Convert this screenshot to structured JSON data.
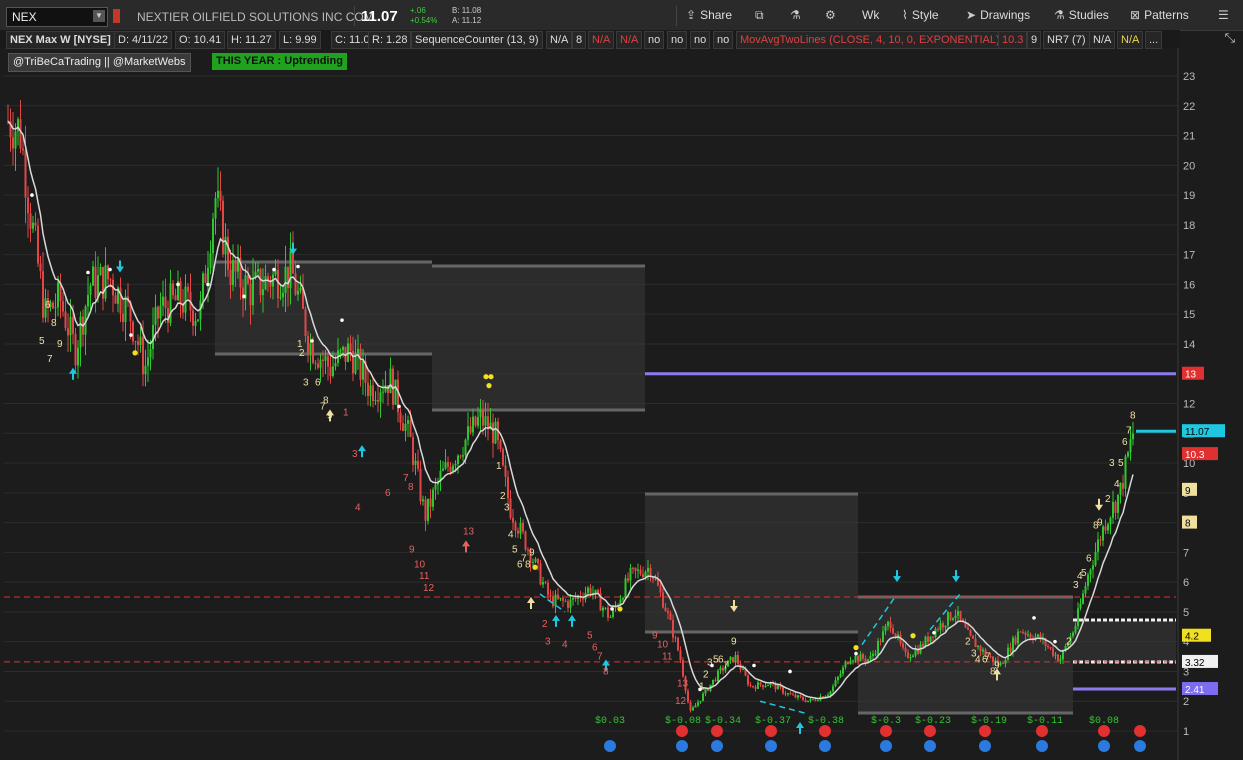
{
  "toolbar": {
    "symbol": "NEX",
    "company": "NEXTIER OILFIELD SOLUTIONS INC COM",
    "last": "11.07",
    "change": "+.06",
    "change_pct": "+0.54%",
    "bid": "B: 11.08",
    "ask": "A: 11.12",
    "share_label": "Share",
    "period_label": "Wk",
    "style_label": "Style",
    "drawings_label": "Drawings",
    "studies_label": "Studies",
    "patterns_label": "Patterns"
  },
  "studybar": {
    "title": "NEX Max W [NYSE]",
    "date": "D: 4/11/22",
    "open": "O: 10.41",
    "high": "H: 11.27",
    "low": "L: 9.99",
    "close": "C: 11.07",
    "range": "R: 1.28",
    "seq": "SequenceCounter (13, 9)",
    "v1": "N/A",
    "v2": "8",
    "v3": "N/A",
    "v4": "N/A",
    "no1": "no",
    "no2": "no",
    "no3": "no",
    "no4": "no",
    "mov": "MovAvgTwoLines (CLOSE, 4, 10, 0, EXPONENTIAL)",
    "mov_val": "10.3",
    "v5": "9",
    "nr7": "NR7 (7)",
    "v6": "N/A",
    "v7": "N/A",
    "more": "..."
  },
  "tags": {
    "twitter": "@TriBeCaTrading || @MarketWebs",
    "status": "THIS YEAR : Uptrending"
  },
  "chart_data": {
    "type": "candlestick",
    "y_ticks": [
      1,
      2,
      3,
      4,
      5,
      6,
      7,
      8,
      9,
      10,
      11,
      12,
      13,
      14,
      15,
      16,
      17,
      18,
      19,
      20,
      21,
      22,
      23
    ],
    "ylim": [
      0.8,
      23.3
    ],
    "last_price": 11.07,
    "price_labels": [
      {
        "value": "13",
        "y": 13.0,
        "color": "#e03030",
        "text_color": "#fff"
      },
      {
        "value": "11.07",
        "y": 11.07,
        "color": "#1ec8e0",
        "text_color": "#000"
      },
      {
        "value": "10.3",
        "y": 10.3,
        "color": "#e03030",
        "text_color": "#fff"
      },
      {
        "value": "9",
        "y": 9.1,
        "color": "#f0e0a0",
        "text_color": "#000"
      },
      {
        "value": "8",
        "y": 8.0,
        "color": "#f0e0a0",
        "text_color": "#000"
      },
      {
        "value": "4.2",
        "y": 4.2,
        "color": "#f0e020",
        "text_color": "#000"
      },
      {
        "value": "3.32",
        "y": 3.32,
        "color": "#f0f0f0",
        "text_color": "#000"
      },
      {
        "value": "2.41",
        "y": 2.41,
        "color": "#7b6cf0",
        "text_color": "#fff"
      }
    ],
    "dividends": [
      "$0.03",
      "$-0.08",
      "$-0.34",
      "$-0.37",
      "$-0.38",
      "$-0.3",
      "$-0.23",
      "$-0.19",
      "$-0.11",
      "$0.08"
    ],
    "colors": {
      "up": "#2ec82e",
      "down": "#e04848",
      "ma": "#d8d8d8",
      "grid": "#2c2c2c"
    }
  }
}
